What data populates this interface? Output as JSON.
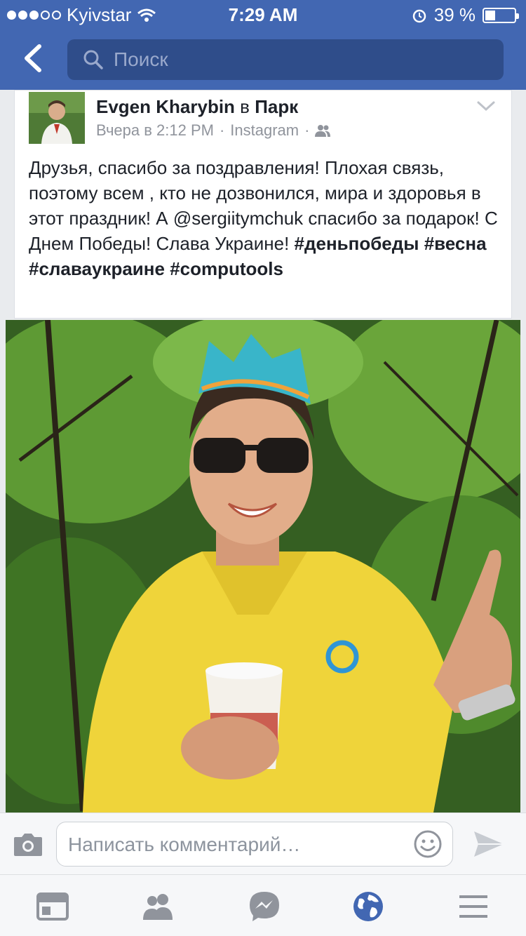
{
  "status_bar": {
    "carrier": "Kyivstar",
    "time": "7:29 AM",
    "battery": "39 %",
    "battery_level": 0.39,
    "signal_bars": 3
  },
  "header": {
    "search_placeholder": "Поиск"
  },
  "post": {
    "author": "Evgen Kharybin",
    "in_word": "в",
    "place": "Парк",
    "time": "Вчера в 2:12 PM",
    "separator": "·",
    "source": "Instagram",
    "text_plain": "Друзья, спасибо за поздравления! Плохая связь, поэтому всем , кто не дозвонился, мира и здоровья в этот праздник! А @sergiitymchuk спасибо за подарок! С Днем Победы! Слава Украине!",
    "hashtags": [
      "#деньпобеды",
      "#весна",
      "#славаукраине",
      "#computools"
    ]
  },
  "comment": {
    "placeholder": "Написать комментарий…"
  },
  "colors": {
    "brand_blue": "#4267b2",
    "search_bg": "#2f4d8a",
    "tab_active": "#4267b2",
    "tab_inactive": "#90949c"
  },
  "icons": {
    "back": "chevron-left-icon",
    "search": "search-icon",
    "post_menu": "chevron-down-icon",
    "audience": "friends-icon",
    "camera": "camera-icon",
    "emoji": "smiley-icon",
    "send": "send-icon",
    "tabs": [
      "news-feed-icon",
      "friends-icon",
      "messenger-icon",
      "globe-icon",
      "menu-icon"
    ]
  }
}
